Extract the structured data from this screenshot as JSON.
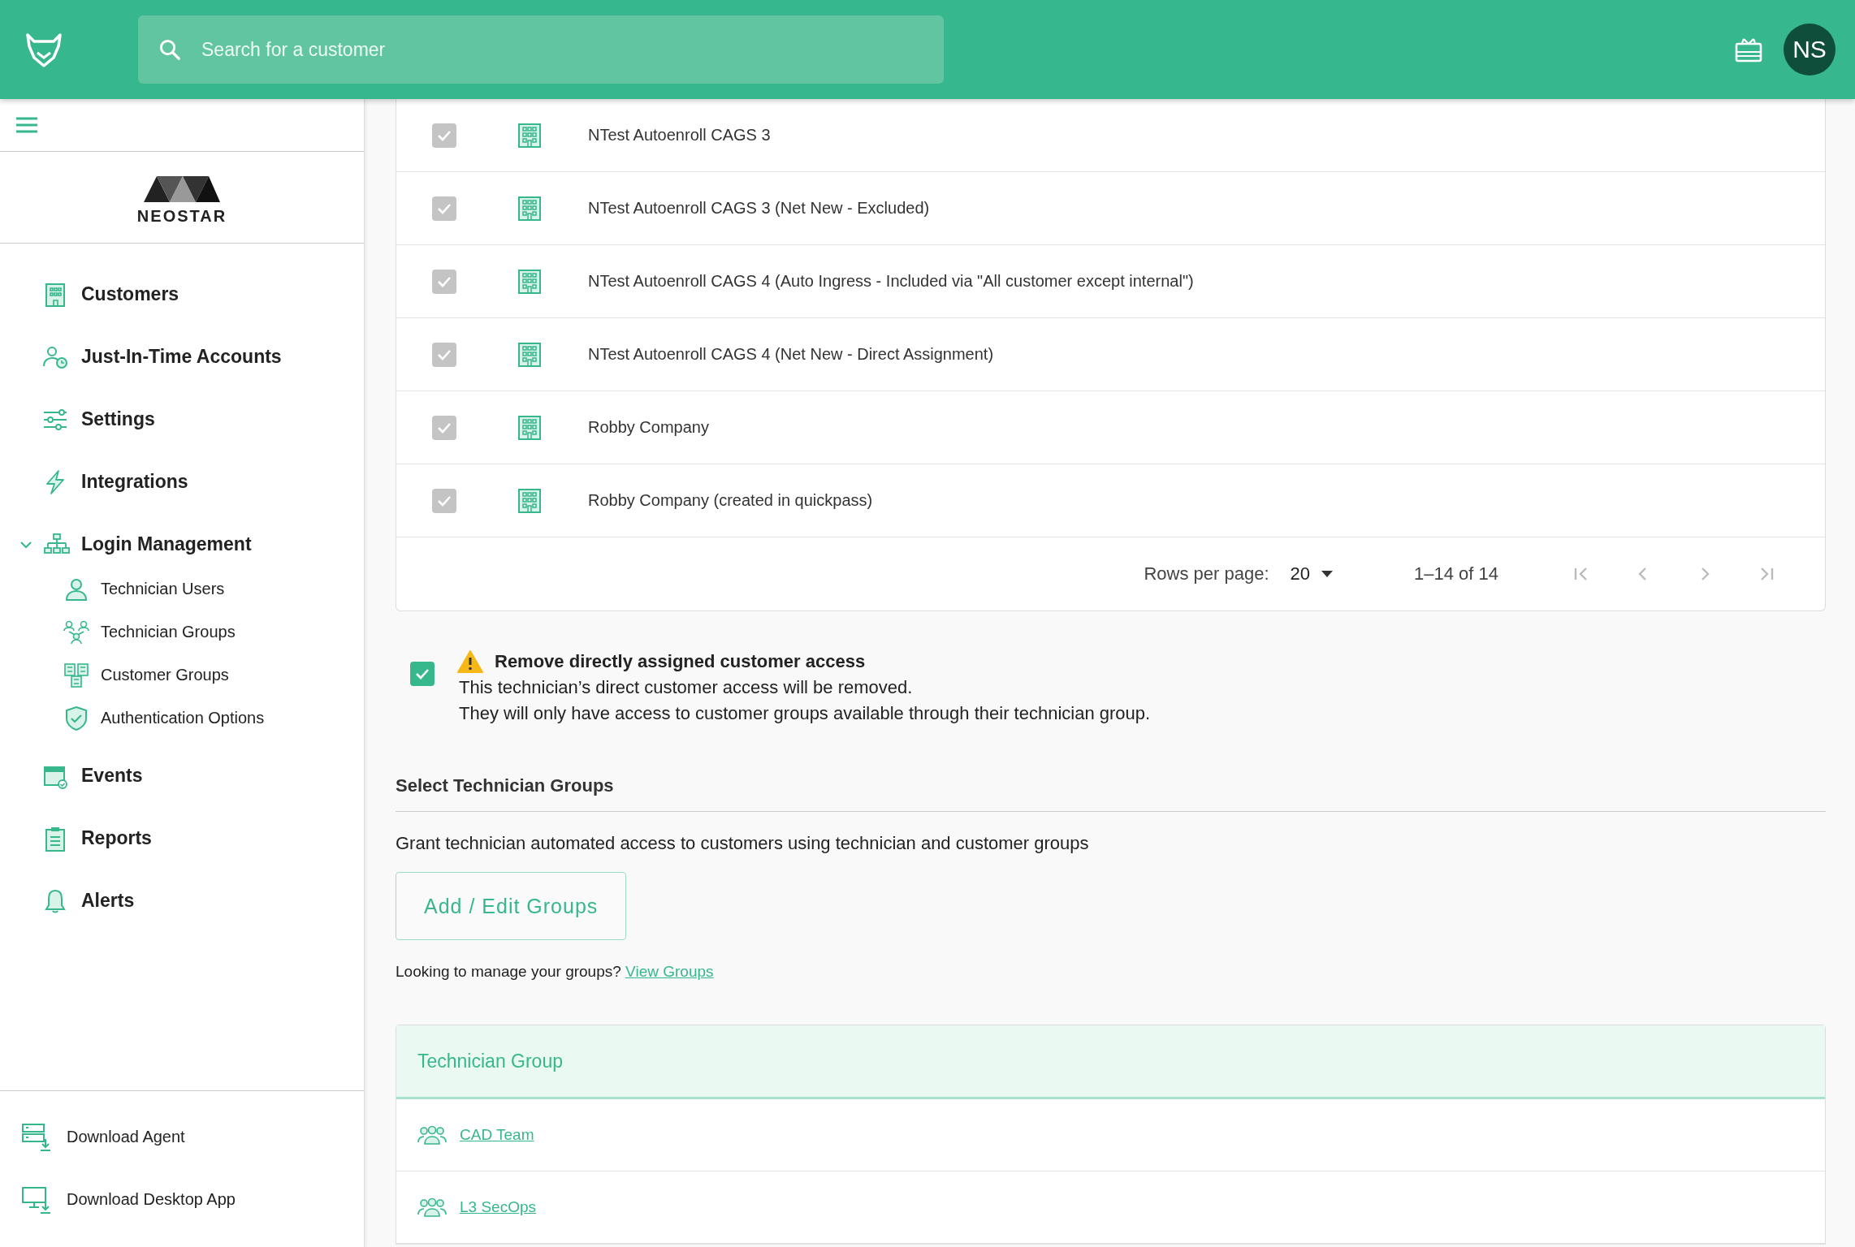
{
  "header": {
    "search": {
      "placeholder": "Search for a customer"
    },
    "avatar": "NS"
  },
  "sidebar": {
    "logo": "NEOSTAR",
    "items": [
      {
        "label": "Customers",
        "kind": "item"
      },
      {
        "label": "Just-In-Time Accounts",
        "kind": "item"
      },
      {
        "label": "Settings",
        "kind": "item"
      },
      {
        "label": "Integrations",
        "kind": "item"
      },
      {
        "label": "Login Management",
        "kind": "group",
        "expanded": true,
        "children": [
          {
            "label": "Technician Users"
          },
          {
            "label": "Technician Groups"
          },
          {
            "label": "Customer Groups"
          },
          {
            "label": "Authentication Options"
          }
        ]
      },
      {
        "label": "Events",
        "kind": "item"
      },
      {
        "label": "Reports",
        "kind": "item"
      },
      {
        "label": "Alerts",
        "kind": "item"
      }
    ],
    "footer": [
      {
        "label": "Download Agent"
      },
      {
        "label": "Download Desktop App"
      }
    ]
  },
  "customers": {
    "rows": [
      {
        "name": "NTest Autoenroll CAGS 3",
        "checked": true,
        "disabled": true
      },
      {
        "name": "NTest Autoenroll CAGS 3 (Net New - Excluded)",
        "checked": true,
        "disabled": true
      },
      {
        "name": "NTest Autoenroll CAGS 4 (Auto Ingress - Included via \"All customer except internal\")",
        "checked": true,
        "disabled": true
      },
      {
        "name": "NTest Autoenroll CAGS 4 (Net New - Direct Assignment)",
        "checked": true,
        "disabled": true
      },
      {
        "name": "Robby Company",
        "checked": true,
        "disabled": true
      },
      {
        "name": "Robby Company (created in quickpass)",
        "checked": true,
        "disabled": true
      }
    ],
    "pagination": {
      "label": "Rows per page:",
      "rows_per_page": "20",
      "range": "1–14 of 14"
    }
  },
  "remove_access": {
    "checked": true,
    "title": "Remove directly assigned customer access",
    "lines": [
      "This technician’s direct customer access will be removed.",
      "They will only have access to customer groups available through their technician group."
    ]
  },
  "technician_groups": {
    "title": "Select Technician Groups",
    "description": "Grant technician automated access to customers using technician and customer groups",
    "button": "Add / Edit Groups",
    "manage_text": "Looking to manage your groups?",
    "manage_link": "View Groups",
    "table": {
      "column": "Technician Group",
      "rows": [
        "CAD Team",
        "L3 SecOps"
      ]
    }
  }
}
